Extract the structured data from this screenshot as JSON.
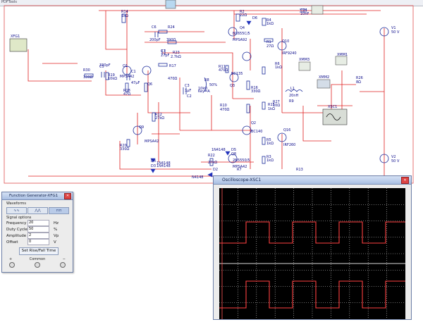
{
  "canvas": {
    "ruler_top_label": "PDFTools",
    "colors": {
      "wire": "#e02020",
      "component": "#1a2a9a",
      "background": "#ffffff",
      "scope_trace": "#e02020",
      "scope_grid": "#d8d8d8"
    }
  },
  "schematic_labels": [
    {
      "id": "r14",
      "text": "R14"
    },
    {
      "id": "r14v",
      "text": "1kΩ"
    },
    {
      "id": "r24",
      "text": "R24"
    },
    {
      "id": "r24v",
      "text": "390Ω"
    },
    {
      "id": "c6",
      "text": "C6"
    },
    {
      "id": "c6v",
      "text": "200pF"
    },
    {
      "id": "r23",
      "text": "R23"
    },
    {
      "id": "r23v",
      "text": "2.7kΩ"
    },
    {
      "id": "c7",
      "text": "C7"
    },
    {
      "id": "c7v",
      "text": "27pF"
    },
    {
      "id": "q4",
      "text": "Q4"
    },
    {
      "id": "q4p",
      "text": "BC655C/5"
    },
    {
      "id": "q5p",
      "text": "MPSA92"
    },
    {
      "id": "d6",
      "text": "D6"
    },
    {
      "id": "r2",
      "text": "R2"
    },
    {
      "id": "r2v",
      "text": "22Ω"
    },
    {
      "id": "r4",
      "text": "R4"
    },
    {
      "id": "r4v",
      "text": "1kΩ"
    },
    {
      "id": "c24",
      "text": "C24"
    },
    {
      "id": "c24v",
      "text": "10nF"
    },
    {
      "id": "r1",
      "text": "R1"
    },
    {
      "id": "r1v",
      "text": "27Ω"
    },
    {
      "id": "q10",
      "text": "Q10"
    },
    {
      "id": "q10p",
      "text": "IRF9240"
    },
    {
      "id": "xfg1",
      "text": "XFG1"
    },
    {
      "id": "r30",
      "text": "R30"
    },
    {
      "id": "r30v",
      "text": "330Ω"
    },
    {
      "id": "c5",
      "text": "C5"
    },
    {
      "id": "c5v",
      "text": "330pF"
    },
    {
      "id": "r19",
      "text": "R19"
    },
    {
      "id": "r19v",
      "text": "10kΩ"
    },
    {
      "id": "q1",
      "text": "Q1"
    },
    {
      "id": "q1p",
      "text": "MPSA42"
    },
    {
      "id": "c1",
      "text": "C1"
    },
    {
      "id": "c1v",
      "text": "47μF"
    },
    {
      "id": "r18",
      "text": "R18"
    },
    {
      "id": "r18v",
      "text": "47Ω"
    },
    {
      "id": "r17",
      "text": "R17"
    },
    {
      "id": "r17v",
      "text": "470Ω"
    },
    {
      "id": "r11",
      "text": "R11"
    },
    {
      "id": "r11v",
      "text": "470Ω"
    },
    {
      "id": "r8",
      "text": "R8"
    },
    {
      "id": "r8v",
      "text": "50%"
    },
    {
      "id": "r8k",
      "text": "10kΩ"
    },
    {
      "id": "r8key",
      "text": "Key=A"
    },
    {
      "id": "q3",
      "text": "Q3"
    },
    {
      "id": "q3p",
      "text": "BC135"
    },
    {
      "id": "r16",
      "text": "R16"
    },
    {
      "id": "r16v",
      "text": "330Ω"
    },
    {
      "id": "r10",
      "text": "R10"
    },
    {
      "id": "r10v",
      "text": "470Ω"
    },
    {
      "id": "c3",
      "text": "C3"
    },
    {
      "id": "c3v",
      "text": "1μF"
    },
    {
      "id": "q6",
      "text": "Q6"
    },
    {
      "id": "r12",
      "text": "R12"
    },
    {
      "id": "r12v",
      "text": "27kΩ"
    },
    {
      "id": "q9",
      "text": "Q9"
    },
    {
      "id": "q11p",
      "text": "MPSA42"
    },
    {
      "id": "r20",
      "text": "R20"
    },
    {
      "id": "r20v",
      "text": "330Ω"
    },
    {
      "id": "l1",
      "text": "L1"
    },
    {
      "id": "l1v",
      "text": "20nH"
    },
    {
      "id": "r6",
      "text": "R6"
    },
    {
      "id": "r6v",
      "text": "1kΩ"
    },
    {
      "id": "r27",
      "text": "R27"
    },
    {
      "id": "r27v",
      "text": "10Ω"
    },
    {
      "id": "r15",
      "text": "R15"
    },
    {
      "id": "r15v",
      "text": "1kΩ"
    },
    {
      "id": "q2",
      "text": "Q2"
    },
    {
      "id": "q2p",
      "text": "BC140"
    },
    {
      "id": "q16",
      "text": "Q16"
    },
    {
      "id": "q16p",
      "text": "IRF260"
    },
    {
      "id": "r5",
      "text": "R5"
    },
    {
      "id": "r5v",
      "text": "1kΩ"
    },
    {
      "id": "r3",
      "text": "R3"
    },
    {
      "id": "r3v",
      "text": "1kΩ"
    },
    {
      "id": "d3",
      "text": "D3"
    },
    {
      "id": "d3p",
      "text": "1N4148"
    },
    {
      "id": "d4",
      "text": "D4"
    },
    {
      "id": "d4p",
      "text": "1N4148"
    },
    {
      "id": "r22",
      "text": "R22"
    },
    {
      "id": "r22v",
      "text": "27kΩ"
    },
    {
      "id": "d5",
      "text": "D5"
    },
    {
      "id": "d5p",
      "text": "1N4148"
    },
    {
      "id": "q8",
      "text": "Q8"
    },
    {
      "id": "q8p",
      "text": "2N5550/5"
    },
    {
      "id": "q5b",
      "text": "MPSA42"
    },
    {
      "id": "d2",
      "text": "D2"
    },
    {
      "id": "n414",
      "text": "N4148"
    },
    {
      "id": "v1",
      "text": "V1"
    },
    {
      "id": "v1v",
      "text": "50 V"
    },
    {
      "id": "v2",
      "text": "V2"
    },
    {
      "id": "v2v",
      "text": "50 V"
    },
    {
      "id": "xmm1",
      "text": "XMM1"
    },
    {
      "id": "xmm3",
      "text": "XMM3"
    },
    {
      "id": "xmm2",
      "text": "XMM2"
    },
    {
      "id": "xsc1",
      "text": "XSC1"
    },
    {
      "id": "r26",
      "text": "R26"
    },
    {
      "id": "r26v",
      "text": "8Ω"
    },
    {
      "id": "r7",
      "text": "R7"
    },
    {
      "id": "c2",
      "text": "C2"
    },
    {
      "id": "r13",
      "text": "R13"
    },
    {
      "id": "r9",
      "text": "R9"
    }
  ],
  "function_generator": {
    "title": "Function Generator-XFG1",
    "section_waveforms": "Waveforms",
    "waveforms": [
      "∿∿",
      "⋀⋀",
      "⊓⊓"
    ],
    "section_signal": "Signal options",
    "fields": [
      {
        "key": "frequency",
        "label": "Frequency",
        "value": "20",
        "unit": "Hz"
      },
      {
        "key": "duty",
        "label": "Duty Cycle",
        "value": "50",
        "unit": "%"
      },
      {
        "key": "amplitude",
        "label": "Amplitude",
        "value": "2",
        "unit": "Vp"
      },
      {
        "key": "offset",
        "label": "Offset",
        "value": "0",
        "unit": "V"
      }
    ],
    "button": "Set Rise/Fall Time",
    "terminals": {
      "plus": "+",
      "common": "Common",
      "minus": "−"
    }
  },
  "oscilloscope": {
    "title": "Oscilloscope-XSC1"
  }
}
